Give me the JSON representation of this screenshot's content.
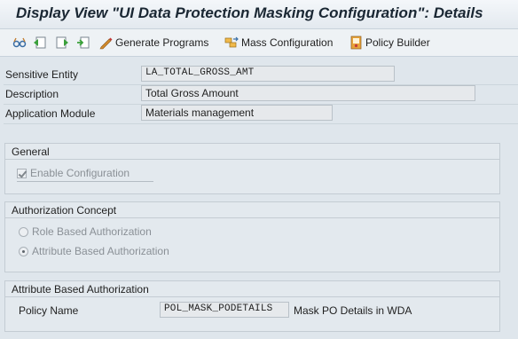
{
  "title": "Display View \"UI Data Protection Masking Configuration\": Details",
  "toolbar": {
    "icons": [
      "glasses-icon",
      "previous-entry-icon",
      "next-entry-icon",
      "export-icon"
    ],
    "generate_programs_label": "Generate Programs",
    "mass_configuration_label": "Mass Configuration",
    "policy_builder_label": "Policy Builder"
  },
  "header_fields": {
    "sensitive_entity_label": "Sensitive Entity",
    "sensitive_entity_value": "LA_TOTAL_GROSS_AMT",
    "description_label": "Description",
    "description_value": "Total Gross Amount",
    "application_module_label": "Application Module",
    "application_module_value": "Materials management"
  },
  "general": {
    "title": "General",
    "enable_configuration_label": "Enable Configuration",
    "enable_configuration_checked": true
  },
  "authorization_concept": {
    "title": "Authorization Concept",
    "role_based_label": "Role Based Authorization",
    "attribute_based_label": "Attribute Based Authorization",
    "selected": "attribute_based"
  },
  "attribute_based_authorization": {
    "title": "Attribute Based Authorization",
    "policy_name_label": "Policy Name",
    "policy_name_value": "POL_MASK_PODETAILS",
    "policy_description": "Mask PO Details in WDA"
  }
}
